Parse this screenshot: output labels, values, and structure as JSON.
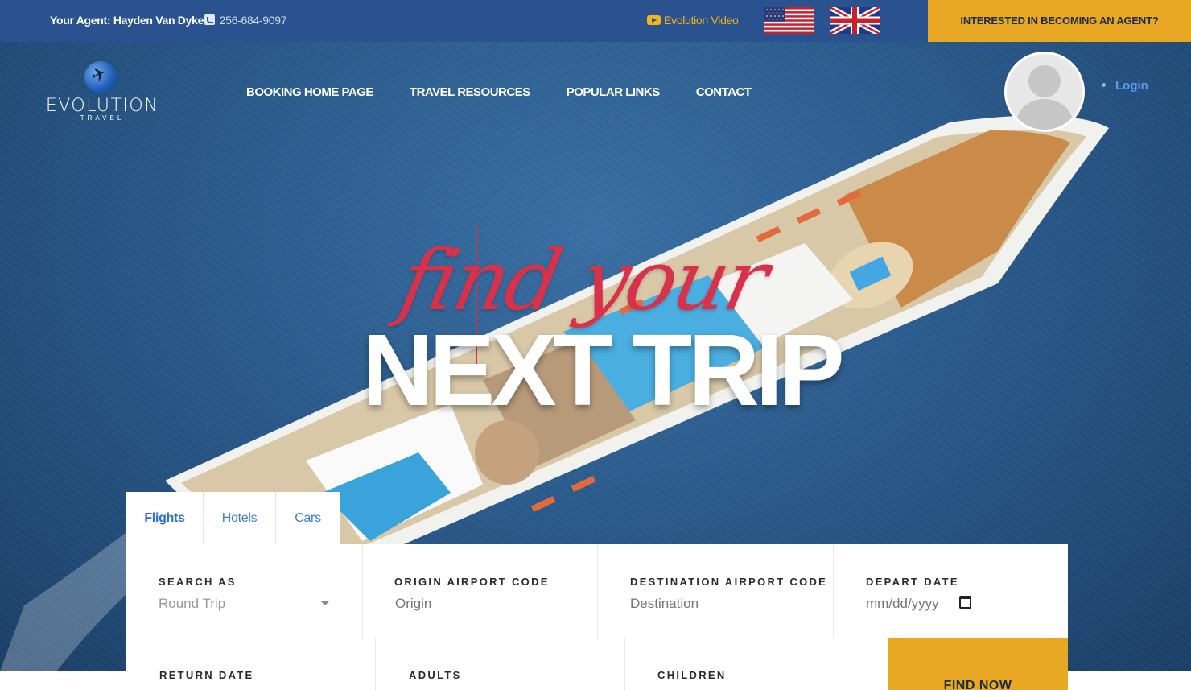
{
  "topbar": {
    "agent_label": "Your Agent: Hayden Van Dyke",
    "agent_phone": "256-684-9097",
    "video_label": "Evolution Video",
    "agent_cta": "INTERESTED IN BECOMING AN AGENT?",
    "colors": {
      "bar": "#2a528e",
      "accent": "#e9a823"
    }
  },
  "logo": {
    "name": "EVOLUTION",
    "sub": "TRAVEL"
  },
  "nav": {
    "items": [
      {
        "label": "BOOKING HOME PAGE"
      },
      {
        "label": "TRAVEL RESOURCES"
      },
      {
        "label": "POPULAR LINKS"
      },
      {
        "label": "CONTACT"
      }
    ]
  },
  "user": {
    "login_label": "Login"
  },
  "hero": {
    "script_text": "find your",
    "headline": "NEXT TRIP"
  },
  "search": {
    "tabs": [
      {
        "label": "Flights",
        "active": true
      },
      {
        "label": "Hotels",
        "active": false
      },
      {
        "label": "Cars",
        "active": false
      }
    ],
    "fields": {
      "search_as": {
        "label": "SEARCH AS",
        "value": "Round Trip"
      },
      "origin": {
        "label": "ORIGIN AIRPORT CODE",
        "placeholder": "Origin"
      },
      "destination": {
        "label": "DESTINATION AIRPORT CODE",
        "placeholder": "Destination"
      },
      "depart": {
        "label": "DEPART DATE",
        "placeholder": "mm/dd/yyyy"
      },
      "return": {
        "label": "RETURN DATE"
      },
      "adults": {
        "label": "ADULTS"
      },
      "children": {
        "label": "CHILDREN"
      }
    },
    "submit_label": "FIND NOW"
  }
}
